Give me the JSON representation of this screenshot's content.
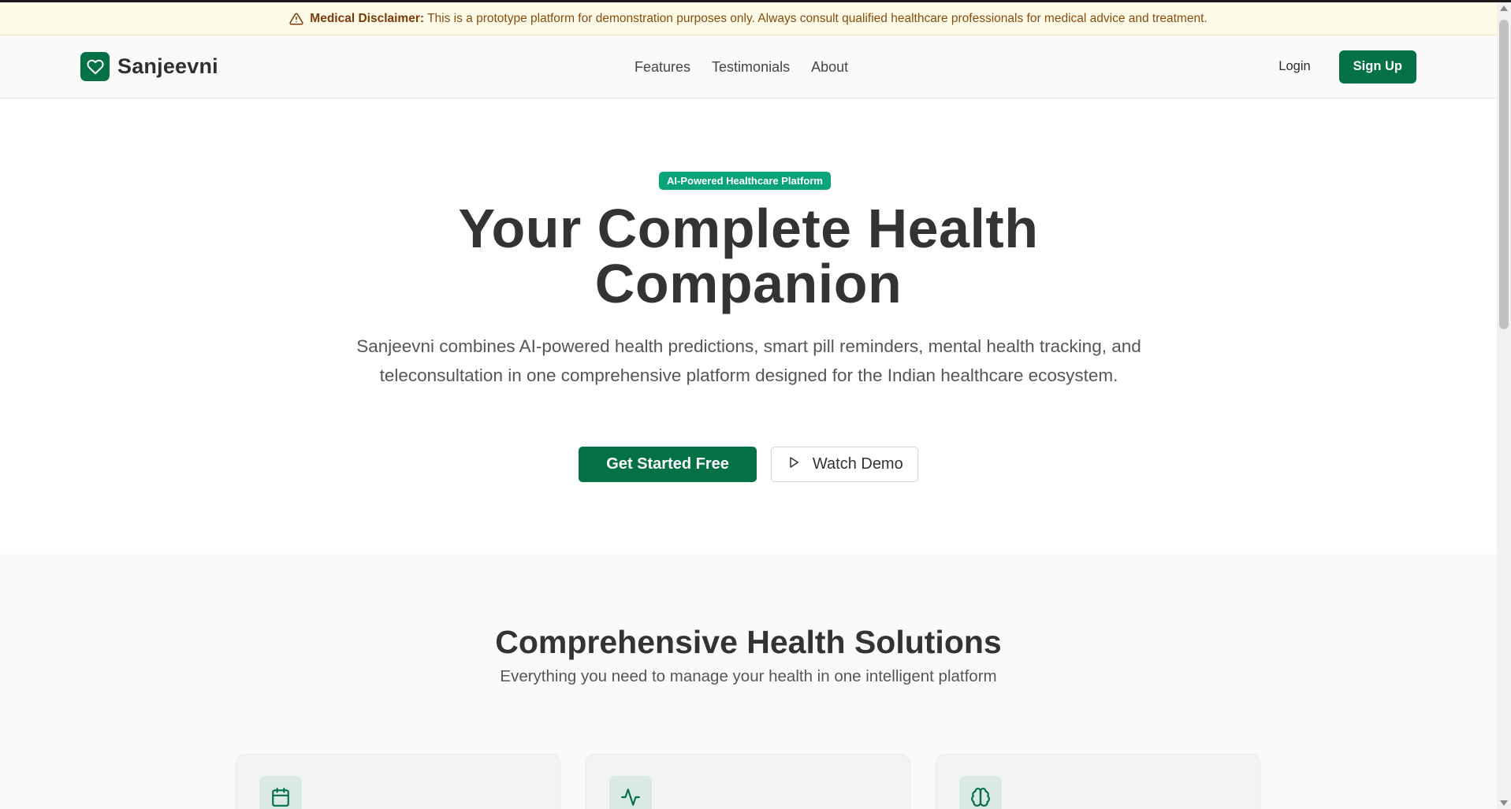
{
  "disclaimer": {
    "icon": "warning-triangle-icon",
    "label": "Medical Disclaimer:",
    "text": "This is a prototype platform for demonstration purposes only. Always consult qualified healthcare professionals for medical advice and treatment."
  },
  "brand": {
    "name": "Sanjeevni",
    "icon": "heart-icon",
    "color": "#047046"
  },
  "nav": {
    "items": [
      {
        "label": "Features"
      },
      {
        "label": "Testimonials"
      },
      {
        "label": "About"
      }
    ]
  },
  "auth": {
    "login_label": "Login",
    "signup_label": "Sign Up"
  },
  "hero": {
    "badge": "AI-Powered Healthcare Platform",
    "title_line1": "Your Complete Health",
    "title_line2": "Companion",
    "description": "Sanjeevni combines AI-powered health predictions, smart pill reminders, mental health tracking, and teleconsultation in one comprehensive platform designed for the Indian healthcare ecosystem.",
    "primary_cta": "Get Started Free",
    "secondary_cta": "Watch Demo",
    "secondary_icon": "play-icon",
    "badge_color": "#0aa37a"
  },
  "features": {
    "title": "Comprehensive Health Solutions",
    "subtitle": "Everything you need to manage your health in one intelligent platform",
    "cards": [
      {
        "icon": "calendar-icon"
      },
      {
        "icon": "activity-pulse-icon"
      },
      {
        "icon": "brain-icon"
      }
    ]
  }
}
